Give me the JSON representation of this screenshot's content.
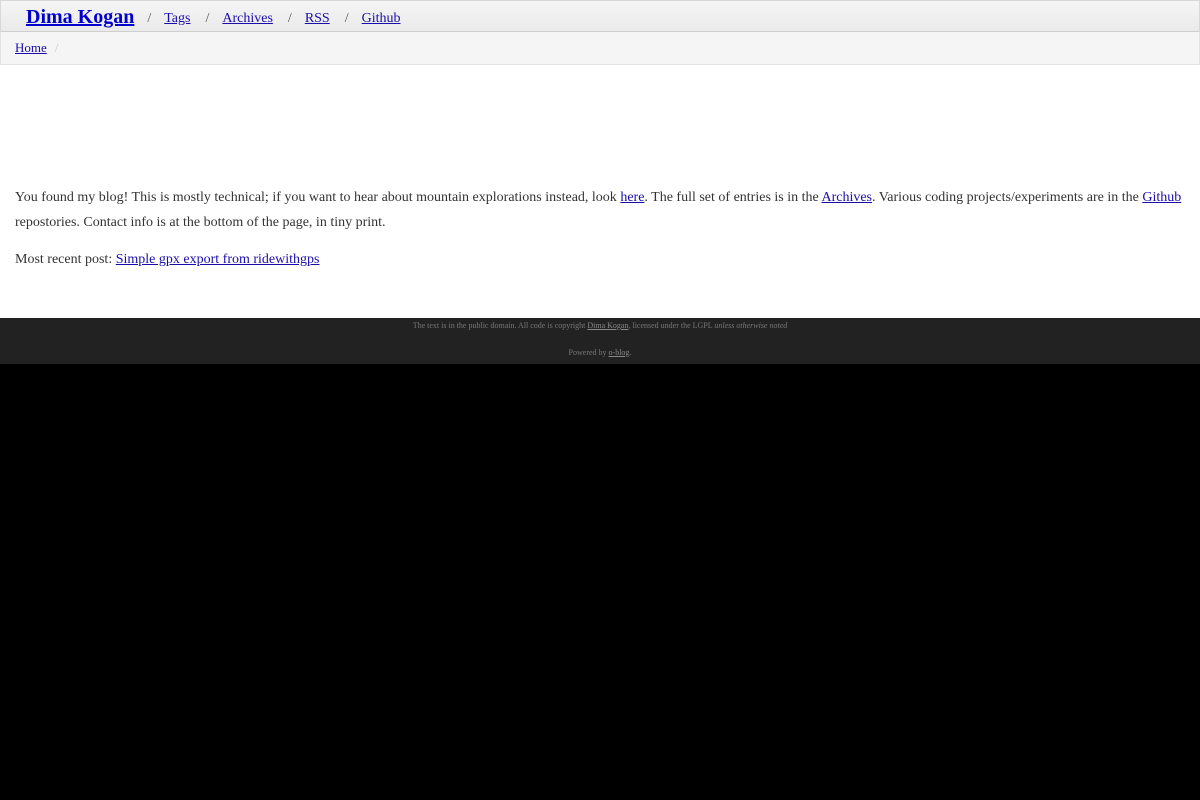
{
  "nav": {
    "brand": "Dima Kogan",
    "sep": "/",
    "links": [
      "Tags",
      "Archives",
      "RSS",
      "Github"
    ]
  },
  "breadcrumb": {
    "home": "Home",
    "divider": "/"
  },
  "intro": {
    "part1": "You found my blog! This is mostly technical; if you want to hear about mountain explorations instead, look ",
    "here_link": "here",
    "part2": ". The full set of entries is in the ",
    "archives_link": "Archives",
    "part3": ". Various coding projects/experiments are in the ",
    "github_link": "Github",
    "part4": " repostories. Contact info is at the bottom of the page, in tiny print."
  },
  "recent": {
    "label": "Most recent post: ",
    "link": "Simple gpx export from ridewithgps"
  },
  "footer": {
    "text1": "The text is in the public domain. All code is copyright ",
    "author_link": "Dima Kogan",
    "text2": ", licensed under the LGPL ",
    "italic": "unless otherwise noted",
    "powered": "Powered by ",
    "engine_link": "o-blog",
    "period": "."
  },
  "colors": {
    "link": "#1a0dab",
    "footer_bg": "#222222",
    "page_bg": "#000000"
  }
}
